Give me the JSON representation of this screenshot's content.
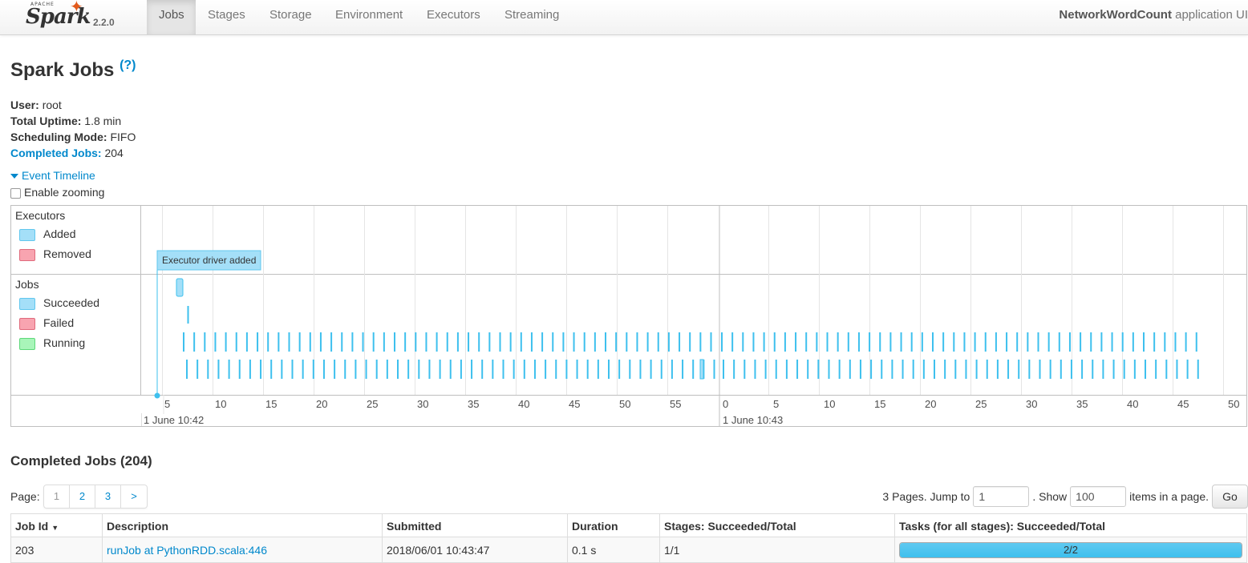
{
  "brand": {
    "apache": "APACHE",
    "name": "Spark",
    "version": "2.2.0"
  },
  "nav": {
    "tabs": [
      {
        "label": "Jobs",
        "active": true
      },
      {
        "label": "Stages"
      },
      {
        "label": "Storage"
      },
      {
        "label": "Environment"
      },
      {
        "label": "Executors"
      },
      {
        "label": "Streaming"
      }
    ],
    "app_name": "NetworkWordCount",
    "app_suffix": " application UI"
  },
  "header": {
    "title": "Spark Jobs",
    "help": "(?)"
  },
  "summary": {
    "user_label": "User:",
    "user": "root",
    "uptime_label": "Total Uptime:",
    "uptime": "1.8 min",
    "mode_label": "Scheduling Mode:",
    "mode": "FIFO",
    "completed_label": "Completed Jobs:",
    "completed": "204"
  },
  "timeline": {
    "toggle_label": "Event Timeline",
    "zoom_label": "Enable zooming",
    "executors_title": "Executors",
    "executor_legend": [
      {
        "label": "Added",
        "color": "#a4dff8",
        "border": "#61c7ee"
      },
      {
        "label": "Removed",
        "color": "#f8a4b0",
        "border": "#e06a7c"
      }
    ],
    "jobs_title": "Jobs",
    "job_legend": [
      {
        "label": "Succeeded",
        "color": "#a4dff8",
        "border": "#61c7ee"
      },
      {
        "label": "Failed",
        "color": "#f8a4b0",
        "border": "#e06a7c"
      },
      {
        "label": "Running",
        "color": "#a8f5b9",
        "border": "#5ed87a"
      }
    ],
    "executor_event": "Executor driver added",
    "minute1_ticks": [
      "5",
      "10",
      "15",
      "20",
      "25",
      "30",
      "35",
      "40",
      "45",
      "50",
      "55"
    ],
    "minute1_label": "1 June 10:42",
    "minute2_ticks": [
      "0",
      "5",
      "10",
      "15",
      "20",
      "25",
      "30",
      "35",
      "40",
      "45",
      "50"
    ],
    "minute2_label": "1 June 10:43"
  },
  "completed": {
    "title": "Completed Jobs (204)",
    "page_label": "Page:",
    "pages": [
      "1",
      "2",
      "3",
      ">"
    ],
    "pages_text": "3 Pages. Jump to",
    "jump_value": "1",
    "show_text": ". Show",
    "show_value": "100",
    "items_text": "items in a page.",
    "go_label": "Go"
  },
  "table": {
    "headers": [
      "Job Id",
      "Description",
      "Submitted",
      "Duration",
      "Stages: Succeeded/Total",
      "Tasks (for all stages): Succeeded/Total"
    ],
    "sort_arrow": "▼",
    "rows": [
      {
        "id": "203",
        "desc": "runJob at PythonRDD.scala:446",
        "submitted": "2018/06/01 10:43:47",
        "duration": "0.1 s",
        "stages": "1/1",
        "tasks": "2/2",
        "tasks_fraction": 1.0
      }
    ]
  }
}
